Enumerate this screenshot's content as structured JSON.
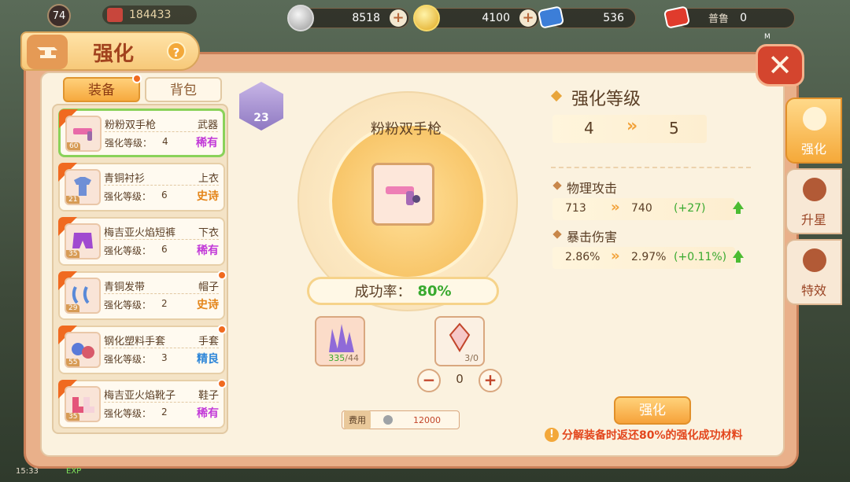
{
  "hud": {
    "avatar_level": "74",
    "power": "184433",
    "silver": "8518",
    "gold": "4100",
    "blue_ticket": "536",
    "red_ticket": "0",
    "location_label": "普鲁",
    "m_marker": "M",
    "add_symbol": "+"
  },
  "panel": {
    "title": "强化",
    "help": "?",
    "close": "✕"
  },
  "tabs": {
    "equip": "装备",
    "bag": "背包"
  },
  "items": [
    {
      "name": "粉粉双手枪",
      "slot": "武器",
      "level_label": "强化等级：",
      "level": "4",
      "rarity": "稀有",
      "thumb_level": "60"
    },
    {
      "name": "青铜衬衫",
      "slot": "上衣",
      "level_label": "强化等级：",
      "level": "6",
      "rarity": "史诗",
      "thumb_level": "21"
    },
    {
      "name": "梅吉亚火焰短裤",
      "slot": "下衣",
      "level_label": "强化等级：",
      "level": "6",
      "rarity": "稀有",
      "thumb_level": "35"
    },
    {
      "name": "青铜发带",
      "slot": "帽子",
      "level_label": "强化等级：",
      "level": "2",
      "rarity": "史诗",
      "thumb_level": "29"
    },
    {
      "name": "钢化塑料手套",
      "slot": "手套",
      "level_label": "强化等级：",
      "level": "3",
      "rarity": "精良",
      "thumb_level": "55"
    },
    {
      "name": "梅吉亚火焰靴子",
      "slot": "鞋子",
      "level_label": "强化等级：",
      "level": "2",
      "rarity": "稀有",
      "thumb_level": "35"
    }
  ],
  "center": {
    "badge_level": "23",
    "weapon_name": "粉粉双手枪",
    "success_label": "成功率：",
    "success_value": "80%",
    "material1_have": "335",
    "material1_need": "/44",
    "material2_count": "3/0",
    "stepper_value": "0",
    "minus": "−",
    "plus": "+",
    "fee_label": "费用",
    "fee_value": "12000"
  },
  "right": {
    "title": "强化等级",
    "level_from": "4",
    "level_to": "5",
    "stat1_name": "物理攻击",
    "stat1_from": "713",
    "stat1_to": "740",
    "stat1_gain": "(+27)",
    "stat2_name": "暴击伤害",
    "stat2_from": "2.86%",
    "stat2_to": "2.97%",
    "stat2_gain": "(+0.11%)",
    "enhance_button": "强化",
    "note": "分解装备时返还80%的强化成功材料",
    "note_icon": "!"
  },
  "side_nav": {
    "enhance": "强化",
    "upgrade": "升星",
    "effect": "特效"
  },
  "bottom": {
    "time": "15:33",
    "exp": "EXP"
  },
  "colors": {
    "accent": "#f6a93e",
    "rare": "#c23ad8",
    "epic": "#e4851a",
    "fine": "#2e86d8",
    "gain": "#38a92e",
    "warning": "#e3461d"
  }
}
